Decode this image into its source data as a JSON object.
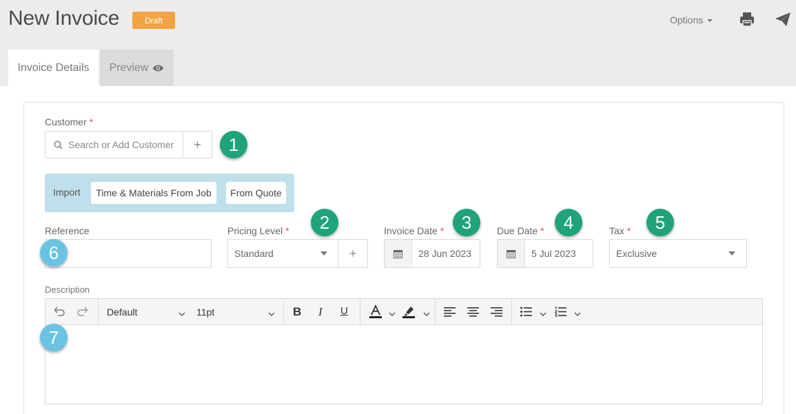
{
  "header": {
    "title": "New Invoice",
    "status": "Draft",
    "options_label": "Options",
    "status_color": "#f2a343"
  },
  "tabs": [
    {
      "label": "Invoice Details",
      "active": true
    },
    {
      "label": "Preview",
      "active": false,
      "icon": "eye-icon"
    }
  ],
  "form": {
    "customer": {
      "label": "Customer",
      "placeholder": "Search or Add Customer",
      "add_label": "+"
    },
    "import": {
      "label": "Import",
      "buttons": [
        "Time & Materials From Job",
        "From Quote"
      ]
    },
    "reference": {
      "label": "Reference",
      "value": ""
    },
    "pricing_level": {
      "label": "Pricing Level",
      "value": "Standard",
      "add_label": "+"
    },
    "invoice_date": {
      "label": "Invoice Date",
      "value": "28 Jun 2023"
    },
    "due_date": {
      "label": "Due Date",
      "value": "5 Jul 2023"
    },
    "tax": {
      "label": "Tax",
      "value": "Exclusive"
    },
    "description": {
      "label": "Description",
      "font_family": "Default",
      "font_size": "11pt"
    },
    "required_marker": "*"
  },
  "callouts": {
    "green": [
      "1",
      "2",
      "3",
      "4",
      "5"
    ],
    "blue": [
      "6",
      "7"
    ],
    "green_color": "#1ea37a",
    "blue_color": "#6bc3e4"
  }
}
